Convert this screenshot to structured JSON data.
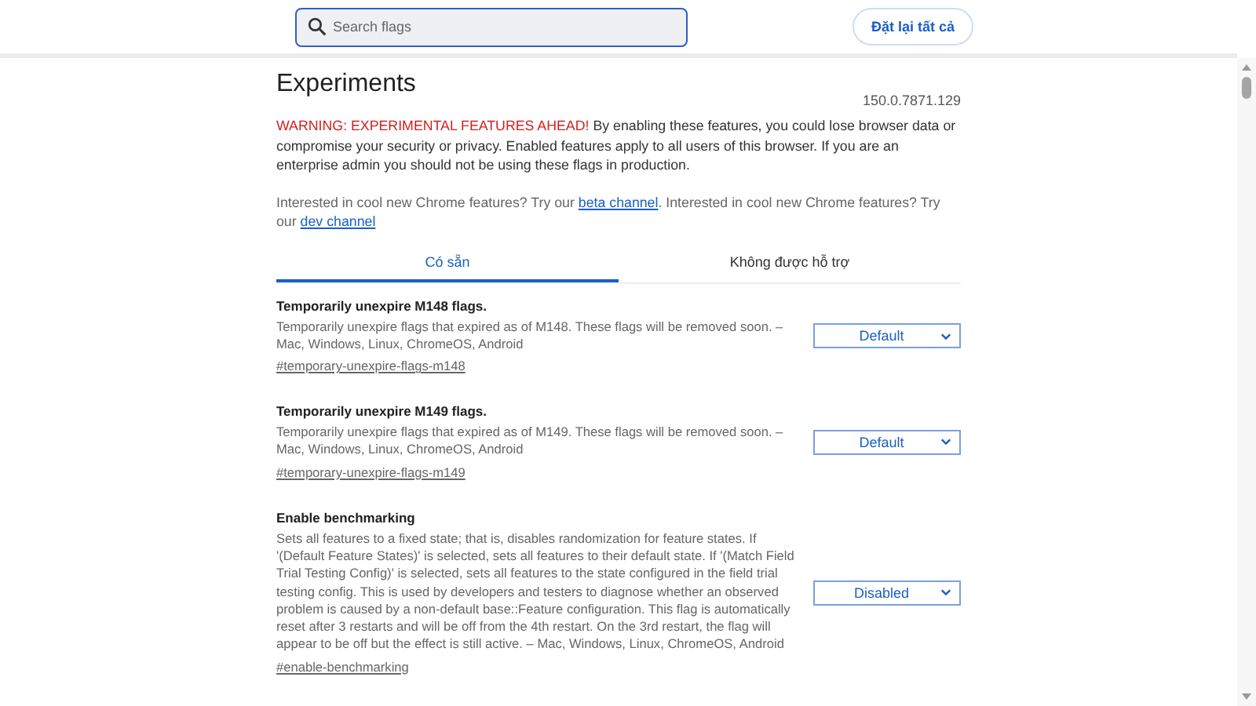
{
  "search": {
    "placeholder": "Search flags"
  },
  "reset_button": "Đặt lại tất cả",
  "title": "Experiments",
  "version": "150.0.7871.129",
  "warning": {
    "label": "WARNING: EXPERIMENTAL FEATURES AHEAD!",
    "text": "By enabling these features, you could lose browser data or compromise your security or privacy. Enabled features apply to all users of this browser. If you are an enterprise admin you should not be using these flags in production."
  },
  "channels": {
    "text_1": "Interested in cool new Chrome features? Try our",
    "link_1": "beta channel",
    "text_2": ". Interested in cool new Chrome features? Try our",
    "link_2": "dev channel"
  },
  "tabs": [
    {
      "label": "Có sẵn",
      "selected": true
    },
    {
      "label": "Không được hỗ trợ",
      "selected": false
    }
  ],
  "flags": [
    {
      "name": "Temporarily unexpire M148 flags.",
      "description": "Temporarily unexpire flags that expired as of M148. These flags will be removed soon. – Mac, Windows, Linux, ChromeOS, Android",
      "link": "#temporary-unexpire-flags-m148",
      "value": "Default"
    },
    {
      "name": "Temporarily unexpire M149 flags.",
      "description": "Temporarily unexpire flags that expired as of M149. These flags will be removed soon. – Mac, Windows, Linux, ChromeOS, Android",
      "link": "#temporary-unexpire-flags-m149",
      "value": "Default"
    },
    {
      "name": "Enable benchmarking",
      "description": "Sets all features to a fixed state; that is, disables randomization for feature states. If '(Default Feature States)' is selected, sets all features to their default state. If '(Match Field Trial Testing Config)' is selected, sets all features to the state configured in the field trial testing config. This is used by developers and testers to diagnose whether an observed problem is caused by a non-default base::Feature configuration. This flag is automatically reset after 3 restarts and will be off from the 4th restart. On the 3rd restart, the flag will appear to be off but the effect is still active. – Mac, Windows, Linux, ChromeOS, Android",
      "link": "#enable-benchmarking",
      "value": "Disabled"
    }
  ]
}
